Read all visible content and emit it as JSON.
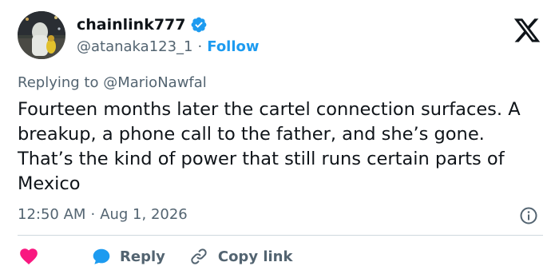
{
  "author": {
    "name": "chainlink777",
    "handle": "@atanaka123_1",
    "separator": "·",
    "follow_label": "Follow",
    "verified_color": "#1d9bf0"
  },
  "reply_to": {
    "prefix": "Replying to",
    "mention": "@MarioNawfal"
  },
  "tweet": {
    "text": "Fourteen months later the cartel connection surfaces. A breakup, a phone call to the father, and she’s gone. That’s the kind of power that still runs certain parts of Mexico"
  },
  "meta": {
    "time": "12:50 AM",
    "separator": "·",
    "date": "Aug 1, 2026"
  },
  "actions": {
    "reply_label": "Reply",
    "copy_link_label": "Copy link"
  },
  "icons": {
    "logo": "x-logo-icon",
    "verified": "verified-badge-icon",
    "info": "info-icon",
    "like": "heart-icon",
    "reply": "reply-bubble-icon",
    "copy": "link-icon"
  },
  "colors": {
    "accent": "#1d9bf0",
    "like": "#f91880",
    "muted": "#536471",
    "text": "#0f1419"
  }
}
